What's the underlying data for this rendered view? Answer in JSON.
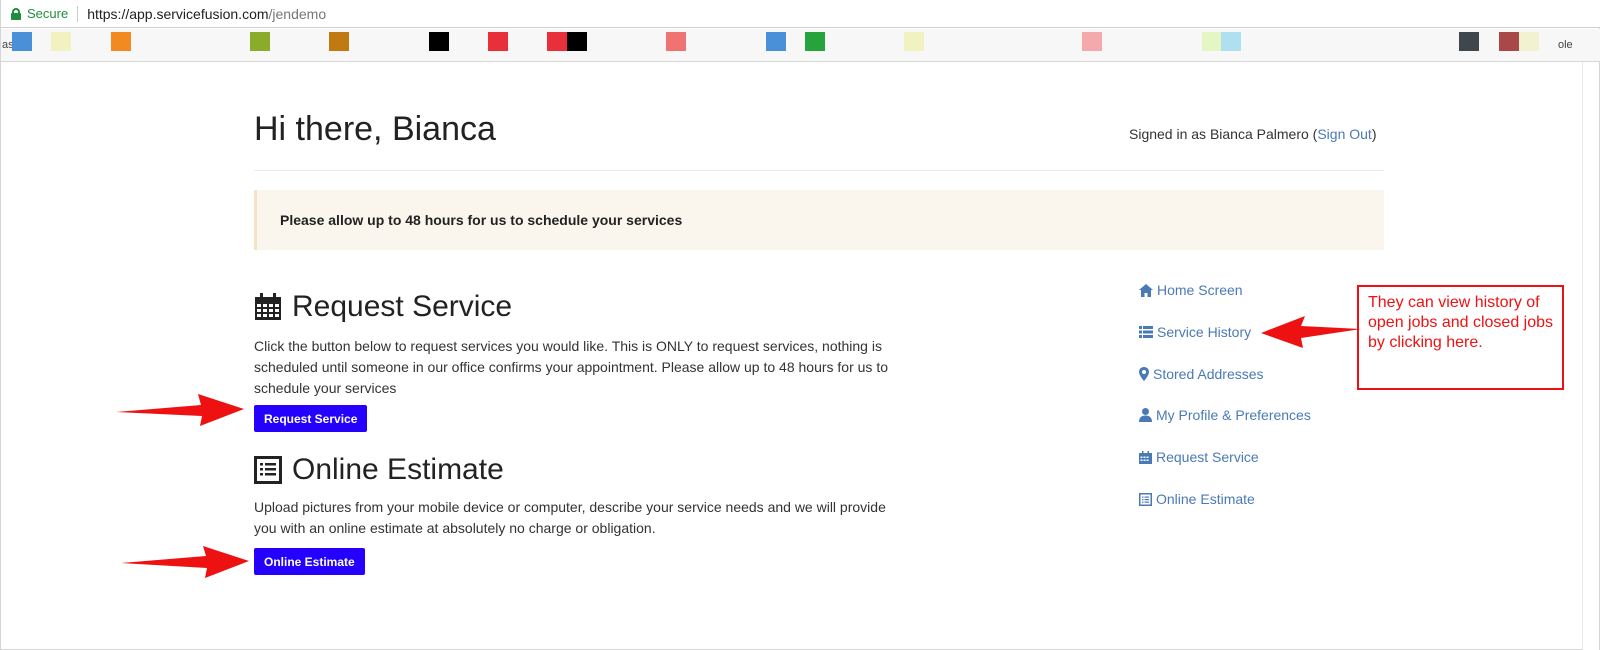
{
  "browser": {
    "secure_label": "Secure",
    "url_base": "https://app.servicefusion.com",
    "url_path": "/jendemo"
  },
  "bookmarks": {
    "items": [
      {
        "color": "#4a90d9"
      },
      {
        "color": "#f2f2c0"
      },
      {
        "color": "#f28a22"
      },
      {
        "color": "#8bab2a"
      },
      {
        "color": "#c07a10"
      },
      {
        "color": "#000000"
      },
      {
        "color": "#e8303a"
      },
      {
        "color": "#e8303a"
      },
      {
        "color": "#000000"
      },
      {
        "color": "#ef7373"
      },
      {
        "color": "#4a90d9"
      },
      {
        "color": "#27a33c"
      },
      {
        "color": "#f2f2c0"
      },
      {
        "color": "#f4a9ad"
      },
      {
        "color": "#e4f6c4"
      },
      {
        "color": "#aee0f2"
      },
      {
        "color": "#3f474d"
      },
      {
        "color": "#a84848"
      },
      {
        "color": "#f2f2d0"
      }
    ],
    "left_text": "as",
    "right_text": "ole"
  },
  "page": {
    "greeting": "Hi there, Bianca",
    "signed_in_prefix": "Signed in as Bianca Palmero (",
    "sign_out_label": "Sign Out",
    "signed_in_suffix": ")",
    "notice": "Please allow up to 48 hours for us to schedule your services"
  },
  "request_service": {
    "title": "Request Service",
    "description": "Click the button below to request services you would like. This is ONLY to request services, nothing is scheduled until someone in our office confirms your appointment. Please allow up to 48 hours for us to schedule your services",
    "button_label": "Request Service"
  },
  "online_estimate": {
    "title": "Online Estimate",
    "description": "Upload pictures from your mobile device or computer, describe your service needs and we will provide you with an online estimate at absolutely no charge or obligation.",
    "button_label": "Online Estimate"
  },
  "sidebar": {
    "items": [
      {
        "label": "Home Screen",
        "icon": "home-icon"
      },
      {
        "label": "Service History",
        "icon": "list-icon"
      },
      {
        "label": "Stored Addresses",
        "icon": "map-marker-icon"
      },
      {
        "label": "My Profile & Preferences",
        "icon": "user-icon"
      },
      {
        "label": "Request Service",
        "icon": "calendar-icon"
      },
      {
        "label": "Online Estimate",
        "icon": "list-alt-icon"
      }
    ]
  },
  "annotation": {
    "callout_text": "They can view history of open jobs and closed jobs by clicking here.",
    "arrow_color": "#ee1111"
  },
  "colors": {
    "link": "#4a7ab6",
    "button": "#2500ff",
    "secure": "#1e8e3e"
  }
}
